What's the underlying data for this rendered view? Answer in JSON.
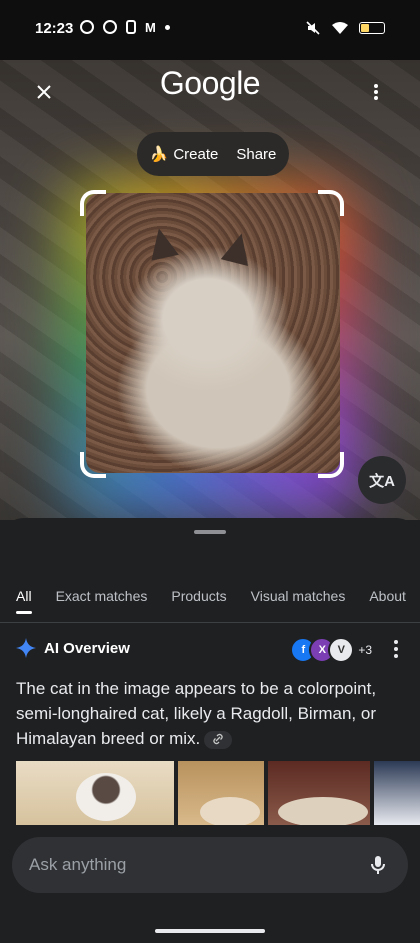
{
  "status_bar": {
    "time": "12:23"
  },
  "top_bar": {
    "logo": "Google"
  },
  "action_pill": {
    "create": "Create",
    "create_emoji": "🍌",
    "share": "Share"
  },
  "translate_glyph": "文A",
  "tabs": [
    {
      "label": "All",
      "active": true
    },
    {
      "label": "Exact matches"
    },
    {
      "label": "Products"
    },
    {
      "label": "Visual matches"
    },
    {
      "label": "About"
    }
  ],
  "ai_overview": {
    "title": "AI Overview",
    "source_extra": "+3",
    "text": "The cat in the image appears to be a colorpoint, semi-longhaired cat, likely a Ragdoll, Birman, or Himalayan breed or mix."
  },
  "search": {
    "placeholder": "Ask anything"
  },
  "colors": {
    "accent_blue": "#4285f4",
    "battery": "#fdd663"
  }
}
